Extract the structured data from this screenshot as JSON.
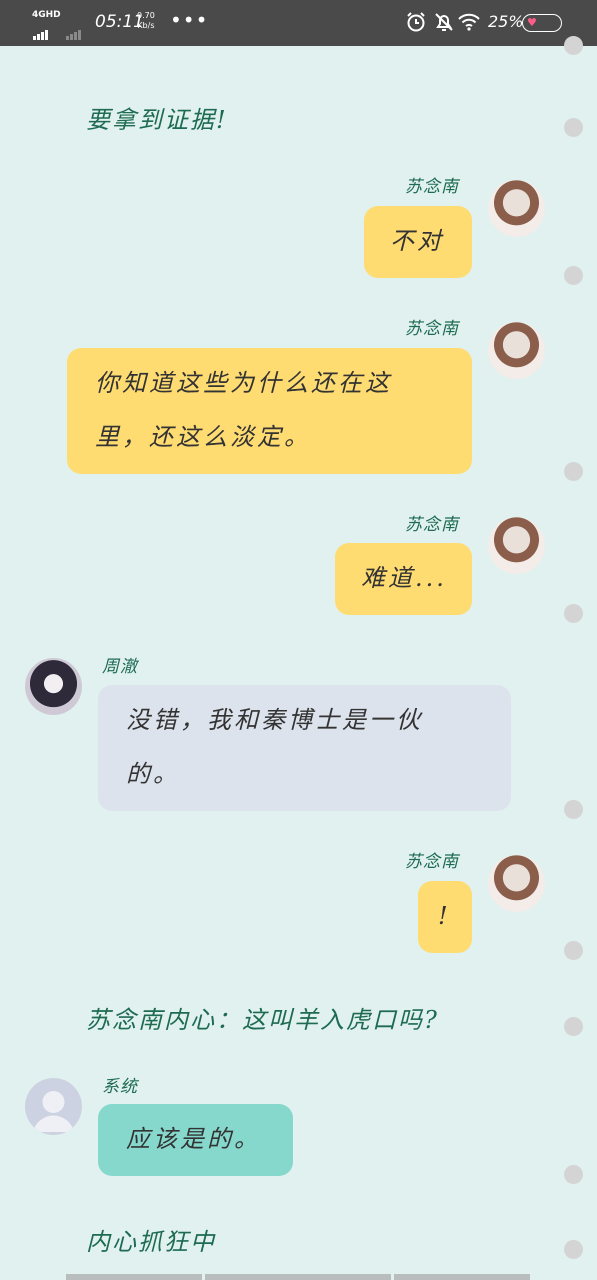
{
  "status_bar": {
    "network": "4GHD",
    "time": "05:11",
    "speed_value": "0.70",
    "speed_unit": "Kb/s",
    "more": "•••",
    "battery_percent": "25%",
    "icons": [
      "alarm-icon",
      "bell-off-icon",
      "wifi-icon",
      "battery-icon"
    ]
  },
  "chat": {
    "narration_1": "要拿到证据!",
    "msg_1": {
      "sender": "苏念南",
      "text": "不对"
    },
    "msg_2": {
      "sender": "苏念南",
      "text_line1": "你知道这些为什么还在这",
      "text_line2": "里，还这么淡定。"
    },
    "msg_3": {
      "sender": "苏念南",
      "text": "难道..."
    },
    "msg_4": {
      "sender": "周澈",
      "text_line1": "没错，我和秦博士是一伙",
      "text_line2": "的。"
    },
    "msg_5": {
      "sender": "苏念南",
      "text": "!"
    },
    "narration_2": "苏念南内心：这叫羊入虎口吗?",
    "msg_6": {
      "sender": "系统",
      "text": "应该是的。"
    },
    "narration_3": "内心抓狂中"
  },
  "colors": {
    "background": "#e0f1ef",
    "self_bubble": "#ffdc72",
    "other_bubble": "#dde3ec",
    "system_bubble": "#86d8cc",
    "name_text": "#1e6b52"
  }
}
